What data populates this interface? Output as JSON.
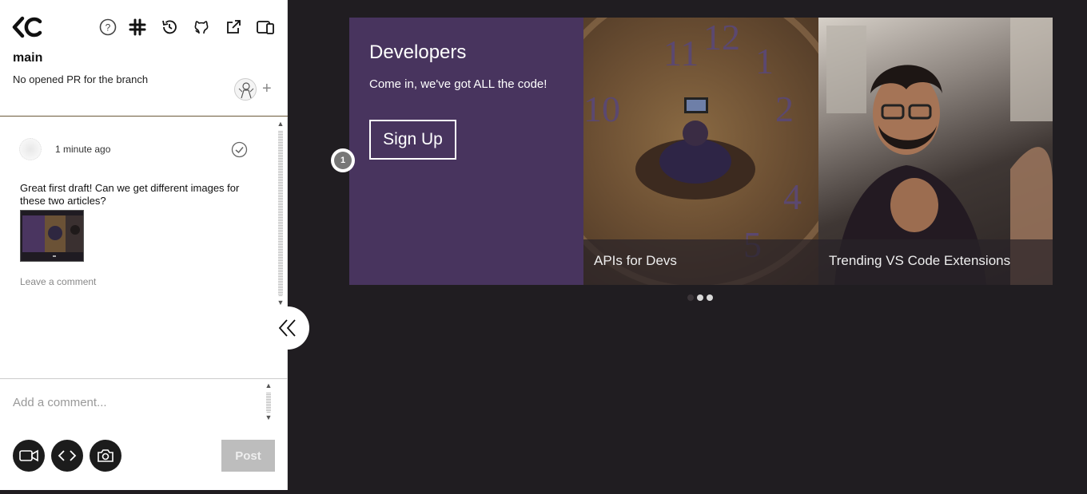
{
  "sidebar": {
    "branch_name": "main",
    "pr_status": "No opened PR for the branch",
    "add_reviewer_symbol": "+",
    "toolbar_icons": [
      "help-icon",
      "slack-icon",
      "history-icon",
      "github-icon",
      "external-link-icon",
      "layout-toggle-icon"
    ],
    "comment": {
      "time": "1 minute ago",
      "text": "Great first draft! Can we get different images for these two articles?",
      "leave_comment": "Leave a comment"
    },
    "input": {
      "placeholder": "Add a comment..."
    },
    "post_label": "Post"
  },
  "main": {
    "hero": {
      "title": "Developers",
      "subtitle": "Come in, we've got ALL the code!",
      "signup_label": "Sign Up"
    },
    "cards": [
      {
        "title": "APIs for Devs"
      },
      {
        "title": "Trending VS Code Extensions"
      }
    ],
    "pin_number": "1",
    "carousel_dots": 3
  },
  "colors": {
    "hero_panel": "#48345e",
    "background": "#201d21",
    "post_disabled": "#bdbdbd"
  }
}
